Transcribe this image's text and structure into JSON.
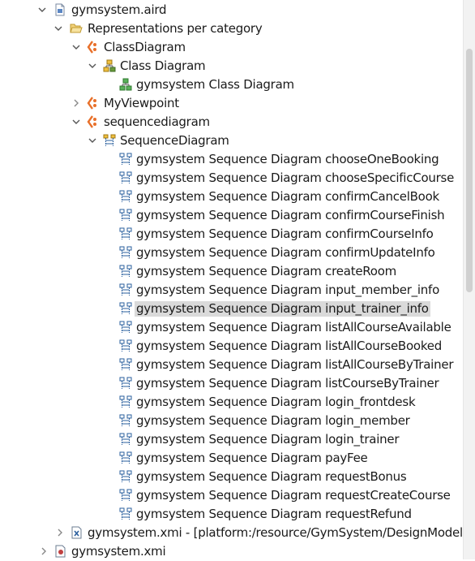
{
  "tree": {
    "root": {
      "label": "gymsystem.aird",
      "expanded": true,
      "icon": "aird-file-icon"
    },
    "representations": {
      "label": "Representations per category",
      "expanded": true,
      "icon": "folder-open-icon"
    },
    "class_viewpoint": {
      "label": "ClassDiagram",
      "expanded": true,
      "icon": "viewpoint-icon"
    },
    "class_description": {
      "label": "Class Diagram",
      "expanded": true,
      "icon": "class-diagram-description-icon"
    },
    "class_representation": {
      "label": "gymsystem Class Diagram",
      "icon": "class-diagram-icon"
    },
    "my_viewpoint": {
      "label": "MyViewpoint",
      "expanded": false,
      "icon": "viewpoint-icon"
    },
    "sequence_viewpoint": {
      "label": "sequencediagram",
      "expanded": true,
      "icon": "viewpoint-icon"
    },
    "sequence_description": {
      "label": "SequenceDiagram",
      "expanded": true,
      "icon": "sequence-diagram-description-icon"
    },
    "sequence_diagrams": [
      {
        "label": "gymsystem Sequence Diagram chooseOneBooking"
      },
      {
        "label": "gymsystem Sequence Diagram chooseSpecificCourse"
      },
      {
        "label": "gymsystem Sequence Diagram confirmCancelBook"
      },
      {
        "label": "gymsystem Sequence Diagram confirmCourseFinish"
      },
      {
        "label": "gymsystem Sequence Diagram confirmCourseInfo"
      },
      {
        "label": "gymsystem Sequence Diagram confirmUpdateInfo"
      },
      {
        "label": "gymsystem Sequence Diagram createRoom"
      },
      {
        "label": "gymsystem Sequence Diagram input_member_info"
      },
      {
        "label": "gymsystem Sequence Diagram input_trainer_info",
        "selected": true
      },
      {
        "label": "gymsystem Sequence Diagram listAllCourseAvailable"
      },
      {
        "label": "gymsystem Sequence Diagram listAllCourseBooked"
      },
      {
        "label": "gymsystem Sequence Diagram listAllCourseByTrainer"
      },
      {
        "label": "gymsystem Sequence Diagram listCourseByTrainer"
      },
      {
        "label": "gymsystem Sequence Diagram login_frontdesk"
      },
      {
        "label": "gymsystem Sequence Diagram login_member"
      },
      {
        "label": "gymsystem Sequence Diagram login_trainer"
      },
      {
        "label": "gymsystem Sequence Diagram payFee"
      },
      {
        "label": "gymsystem Sequence Diagram requestBonus"
      },
      {
        "label": "gymsystem Sequence Diagram requestCreateCourse"
      },
      {
        "label": "gymsystem Sequence Diagram requestRefund"
      }
    ],
    "xmi_resource": {
      "label": "gymsystem.xmi - [platform:/resource/GymSystem/DesignModel/",
      "expanded": false,
      "icon": "xmi-resource-icon"
    },
    "xmi_file": {
      "label": "gymsystem.xmi",
      "expanded": false,
      "icon": "xmi-file-icon"
    }
  },
  "colors": {
    "selection": "#dadada",
    "viewpoint_orange": "#e8702a",
    "diagram_blue": "#2a5f9e",
    "class_green": "#3c9a3c",
    "folder_yellow": "#e0b43c"
  }
}
